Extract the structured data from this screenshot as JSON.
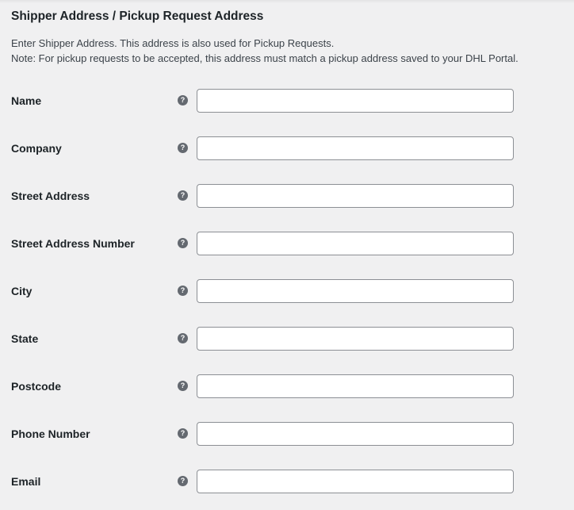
{
  "section": {
    "title": "Shipper Address / Pickup Request Address",
    "description": [
      "Enter Shipper Address. This address is also used for Pickup Requests.",
      "Note: For pickup requests to be accepted, this address must match a pickup address saved to your DHL Portal."
    ]
  },
  "help_icon_glyph": "?",
  "fields": [
    {
      "key": "name",
      "label": "Name",
      "value": "",
      "placeholder": ""
    },
    {
      "key": "company",
      "label": "Company",
      "value": "",
      "placeholder": ""
    },
    {
      "key": "street-address",
      "label": "Street Address",
      "value": "",
      "placeholder": ""
    },
    {
      "key": "street-address-number",
      "label": "Street Address Number",
      "value": "",
      "placeholder": ""
    },
    {
      "key": "city",
      "label": "City",
      "value": "",
      "placeholder": ""
    },
    {
      "key": "state",
      "label": "State",
      "value": "",
      "placeholder": ""
    },
    {
      "key": "postcode",
      "label": "Postcode",
      "value": "",
      "placeholder": ""
    },
    {
      "key": "phone-number",
      "label": "Phone Number",
      "value": "",
      "placeholder": ""
    },
    {
      "key": "email",
      "label": "Email",
      "value": "",
      "placeholder": ""
    }
  ],
  "colors": {
    "background": "#f0f0f1",
    "text": "#1d2327",
    "muted_text": "#3c434a",
    "input_border": "#8c8f94",
    "help_icon": "#646970"
  }
}
